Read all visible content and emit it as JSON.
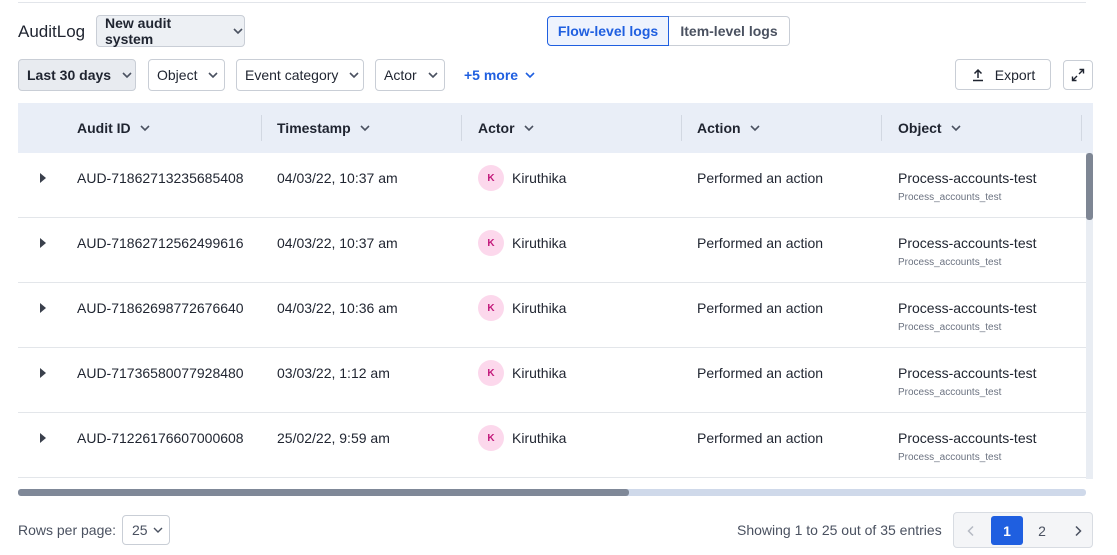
{
  "header": {
    "title": "AuditLog",
    "system_select": "New audit system",
    "tabs": [
      {
        "label": "Flow-level logs",
        "active": true
      },
      {
        "label": "Item-level logs",
        "active": false
      }
    ]
  },
  "filters": {
    "date_range": "Last 30 days",
    "object": "Object",
    "event_category": "Event category",
    "actor": "Actor",
    "more": "+5 more"
  },
  "actions": {
    "export_label": "Export",
    "expand_icon": "expand-icon"
  },
  "table": {
    "columns": [
      "Audit ID",
      "Timestamp",
      "Actor",
      "Action",
      "Object"
    ],
    "rows": [
      {
        "id": "AUD-71862713235685408",
        "timestamp": "04/03/22, 10:37 am",
        "avatar": "K",
        "actor": "Kiruthika",
        "action": "Performed an action",
        "object": "Process-accounts-test",
        "object_sub": "Process_accounts_test"
      },
      {
        "id": "AUD-71862712562499616",
        "timestamp": "04/03/22, 10:37 am",
        "avatar": "K",
        "actor": "Kiruthika",
        "action": "Performed an action",
        "object": "Process-accounts-test",
        "object_sub": "Process_accounts_test"
      },
      {
        "id": "AUD-71862698772676640",
        "timestamp": "04/03/22, 10:36 am",
        "avatar": "K",
        "actor": "Kiruthika",
        "action": "Performed an action",
        "object": "Process-accounts-test",
        "object_sub": "Process_accounts_test"
      },
      {
        "id": "AUD-71736580077928480",
        "timestamp": "03/03/22, 1:12 am",
        "avatar": "K",
        "actor": "Kiruthika",
        "action": "Performed an action",
        "object": "Process-accounts-test",
        "object_sub": "Process_accounts_test"
      },
      {
        "id": "AUD-71226176607000608",
        "timestamp": "25/02/22, 9:59 am",
        "avatar": "K",
        "actor": "Kiruthika",
        "action": "Performed an action",
        "object": "Process-accounts-test",
        "object_sub": "Process_accounts_test"
      }
    ]
  },
  "footer": {
    "rows_per_page_label": "Rows per page:",
    "rows_per_page_value": "25",
    "showing_text": "Showing 1 to 25 out of 35 entries",
    "pages": [
      "1",
      "2"
    ],
    "current_page": "1"
  },
  "colors": {
    "accent": "#1f5fe0",
    "header_bg": "#e9eef7",
    "avatar_bg": "#fcd8ec",
    "avatar_text": "#c2187a"
  }
}
